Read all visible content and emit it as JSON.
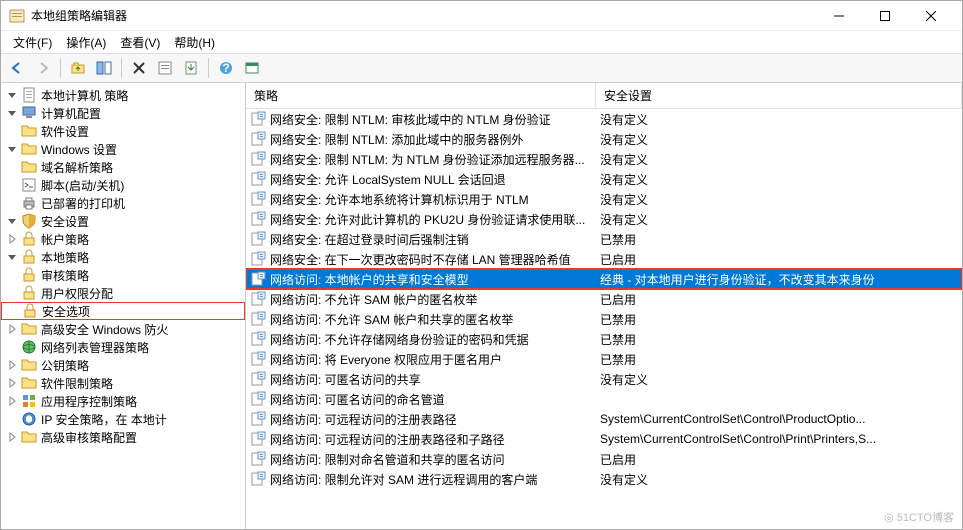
{
  "window": {
    "title": "本地组策略编辑器"
  },
  "menu": {
    "file": "文件(F)",
    "action": "操作(A)",
    "view": "查看(V)",
    "help": "帮助(H)"
  },
  "tree": {
    "root": "本地计算机 策略",
    "computer_config": "计算机配置",
    "software_settings": "软件设置",
    "windows_settings": "Windows 设置",
    "dns_policy": "域名解析策略",
    "scripts": "脚本(启动/关机)",
    "deployed_printers": "已部署的打印机",
    "security_settings": "安全设置",
    "account_policy": "帐户策略",
    "local_policy": "本地策略",
    "audit_policy": "审核策略",
    "user_rights": "用户权限分配",
    "security_options": "安全选项",
    "adv_firewall": "高级安全 Windows 防火",
    "network_list": "网络列表管理器策略",
    "public_key": "公钥策略",
    "software_restrict": "软件限制策略",
    "app_control": "应用程序控制策略",
    "ip_sec": "IP 安全策略，在 本地计",
    "adv_audit": "高级审核策略配置"
  },
  "columns": {
    "policy": "策略",
    "setting": "安全设置"
  },
  "rows": [
    {
      "name": "网络安全: 限制 NTLM: 审核此域中的 NTLM 身份验证",
      "setting": "没有定义"
    },
    {
      "name": "网络安全: 限制 NTLM: 添加此域中的服务器例外",
      "setting": "没有定义"
    },
    {
      "name": "网络安全: 限制 NTLM: 为 NTLM 身份验证添加远程服务器...",
      "setting": "没有定义"
    },
    {
      "name": "网络安全: 允许 LocalSystem NULL 会话回退",
      "setting": "没有定义"
    },
    {
      "name": "网络安全: 允许本地系统将计算机标识用于 NTLM",
      "setting": "没有定义"
    },
    {
      "name": "网络安全: 允许对此计算机的 PKU2U 身份验证请求使用联...",
      "setting": "没有定义"
    },
    {
      "name": "网络安全: 在超过登录时间后强制注销",
      "setting": "已禁用"
    },
    {
      "name": "网络安全: 在下一次更改密码时不存储 LAN 管理器哈希值",
      "setting": "已启用"
    },
    {
      "name": "网络访问: 本地帐户的共享和安全模型",
      "setting": "经典 - 对本地用户进行身份验证，不改变其本来身份",
      "selected": true
    },
    {
      "name": "网络访问: 不允许 SAM 帐户的匿名枚举",
      "setting": "已启用"
    },
    {
      "name": "网络访问: 不允许 SAM 帐户和共享的匿名枚举",
      "setting": "已禁用"
    },
    {
      "name": "网络访问: 不允许存储网络身份验证的密码和凭据",
      "setting": "已禁用"
    },
    {
      "name": "网络访问: 将 Everyone 权限应用于匿名用户",
      "setting": "已禁用"
    },
    {
      "name": "网络访问: 可匿名访问的共享",
      "setting": "没有定义"
    },
    {
      "name": "网络访问: 可匿名访问的命名管道",
      "setting": ""
    },
    {
      "name": "网络访问: 可远程访问的注册表路径",
      "setting": "System\\CurrentControlSet\\Control\\ProductOptio..."
    },
    {
      "name": "网络访问: 可远程访问的注册表路径和子路径",
      "setting": "System\\CurrentControlSet\\Control\\Print\\Printers,S..."
    },
    {
      "name": "网络访问: 限制对命名管道和共享的匿名访问",
      "setting": "已启用"
    },
    {
      "name": "网络访问: 限制允许对 SAM 进行远程调用的客户端",
      "setting": "没有定义"
    }
  ],
  "watermark": "◎ 51CTO博客"
}
